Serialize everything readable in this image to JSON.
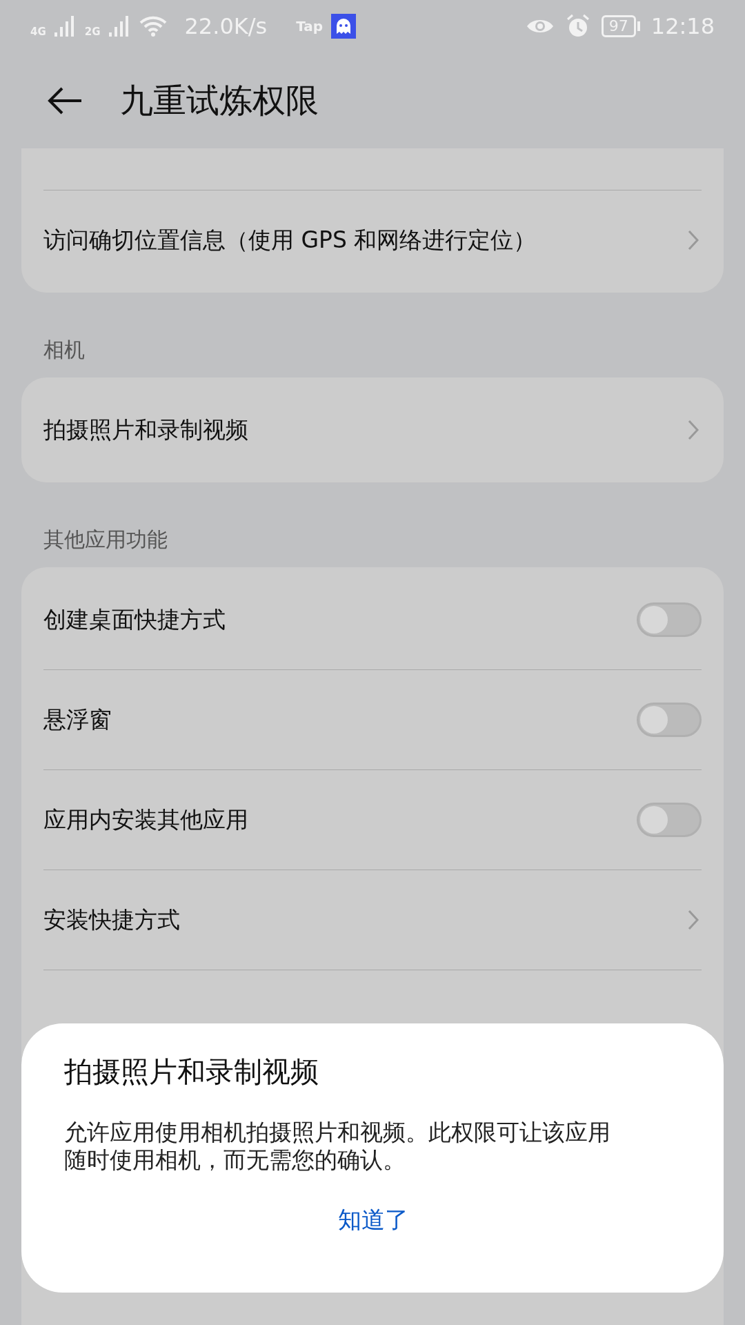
{
  "status_bar": {
    "network_1": "4G",
    "network_2": "2G",
    "speed": "22.0K/s",
    "tap_label": "Tap",
    "battery": "97",
    "time": "12:18"
  },
  "header": {
    "title": "九重试炼权限"
  },
  "sections": [
    {
      "rows": [
        {
          "kind": "link",
          "text": "访问确切位置信息（使用 GPS 和网络进行定位）"
        }
      ]
    },
    {
      "label": "相机",
      "rows": [
        {
          "kind": "link",
          "text": "拍摄照片和录制视频"
        }
      ]
    },
    {
      "label": "其他应用功能",
      "rows": [
        {
          "kind": "toggle",
          "text": "创建桌面快捷方式",
          "on": false
        },
        {
          "kind": "toggle",
          "text": "悬浮窗",
          "on": false
        },
        {
          "kind": "toggle",
          "text": "应用内安装其他应用",
          "on": false
        },
        {
          "kind": "link",
          "text": "安装快捷方式"
        }
      ]
    }
  ],
  "dialog": {
    "title": "拍摄照片和录制视频",
    "body": "允许应用使用相机拍摄照片和视频。此权限可让该应用随时使用相机，而无需您的确认。",
    "button": "知道了"
  }
}
